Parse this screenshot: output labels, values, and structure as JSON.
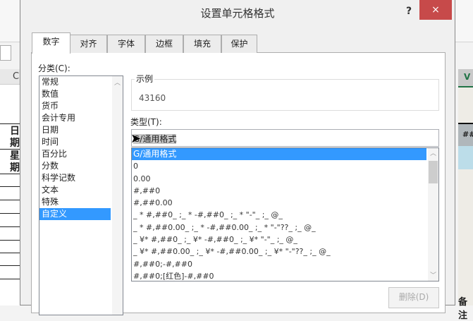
{
  "spreadsheet": {
    "col_left": "C",
    "col_right": "V",
    "header_cells": [
      "日期",
      "星期"
    ],
    "right_header": "##",
    "bottom_right_text": "备注"
  },
  "dialog": {
    "title": "设置单元格格式",
    "help": "?",
    "close": "×",
    "tabs": [
      "数字",
      "对齐",
      "字体",
      "边框",
      "填充",
      "保护"
    ],
    "category_label": "分类(C):",
    "categories": [
      "常规",
      "数值",
      "货币",
      "会计专用",
      "日期",
      "时间",
      "百分比",
      "分数",
      "科学记数",
      "文本",
      "特殊",
      "自定义"
    ],
    "selected_category": "自定义",
    "sample_label": "示例",
    "sample_value": "43160",
    "type_label": "类型(T):",
    "type_value": "G/通用格式",
    "formats": [
      "G/通用格式",
      "0",
      "0.00",
      "#,##0",
      "#,##0.00",
      "_ * #,##0_ ;_ * -#,##0_ ;_ * \"-\"_ ;_ @_ ",
      "_ * #,##0.00_ ;_ * -#,##0.00_ ;_ * \"-\"??_ ;_ @_ ",
      "_ ¥* #,##0_ ;_ ¥* -#,##0_ ;_ ¥* \"-\"_ ;_ @_ ",
      "_ ¥* #,##0.00_ ;_ ¥* -#,##0.00_ ;_ ¥* \"-\"??_ ;_ @_ ",
      "#,##0;-#,##0",
      "#,##0;[红色]-#,##0"
    ],
    "delete_label": "删除(D)"
  }
}
